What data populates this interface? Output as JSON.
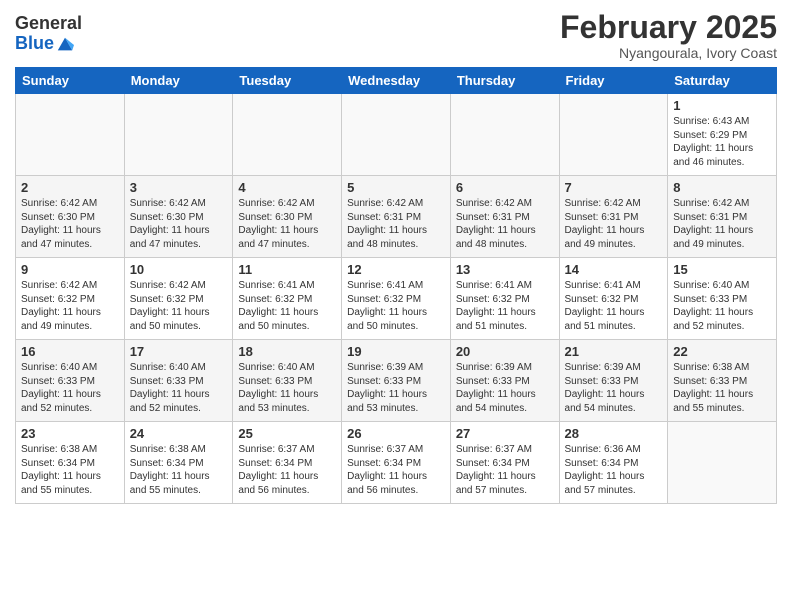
{
  "header": {
    "logo_general": "General",
    "logo_blue": "Blue",
    "month_title": "February 2025",
    "subtitle": "Nyangourala, Ivory Coast"
  },
  "days_of_week": [
    "Sunday",
    "Monday",
    "Tuesday",
    "Wednesday",
    "Thursday",
    "Friday",
    "Saturday"
  ],
  "weeks": [
    [
      {
        "day": "",
        "info": ""
      },
      {
        "day": "",
        "info": ""
      },
      {
        "day": "",
        "info": ""
      },
      {
        "day": "",
        "info": ""
      },
      {
        "day": "",
        "info": ""
      },
      {
        "day": "",
        "info": ""
      },
      {
        "day": "1",
        "info": "Sunrise: 6:43 AM\nSunset: 6:29 PM\nDaylight: 11 hours and 46 minutes."
      }
    ],
    [
      {
        "day": "2",
        "info": "Sunrise: 6:42 AM\nSunset: 6:30 PM\nDaylight: 11 hours and 47 minutes."
      },
      {
        "day": "3",
        "info": "Sunrise: 6:42 AM\nSunset: 6:30 PM\nDaylight: 11 hours and 47 minutes."
      },
      {
        "day": "4",
        "info": "Sunrise: 6:42 AM\nSunset: 6:30 PM\nDaylight: 11 hours and 47 minutes."
      },
      {
        "day": "5",
        "info": "Sunrise: 6:42 AM\nSunset: 6:31 PM\nDaylight: 11 hours and 48 minutes."
      },
      {
        "day": "6",
        "info": "Sunrise: 6:42 AM\nSunset: 6:31 PM\nDaylight: 11 hours and 48 minutes."
      },
      {
        "day": "7",
        "info": "Sunrise: 6:42 AM\nSunset: 6:31 PM\nDaylight: 11 hours and 49 minutes."
      },
      {
        "day": "8",
        "info": "Sunrise: 6:42 AM\nSunset: 6:31 PM\nDaylight: 11 hours and 49 minutes."
      }
    ],
    [
      {
        "day": "9",
        "info": "Sunrise: 6:42 AM\nSunset: 6:32 PM\nDaylight: 11 hours and 49 minutes."
      },
      {
        "day": "10",
        "info": "Sunrise: 6:42 AM\nSunset: 6:32 PM\nDaylight: 11 hours and 50 minutes."
      },
      {
        "day": "11",
        "info": "Sunrise: 6:41 AM\nSunset: 6:32 PM\nDaylight: 11 hours and 50 minutes."
      },
      {
        "day": "12",
        "info": "Sunrise: 6:41 AM\nSunset: 6:32 PM\nDaylight: 11 hours and 50 minutes."
      },
      {
        "day": "13",
        "info": "Sunrise: 6:41 AM\nSunset: 6:32 PM\nDaylight: 11 hours and 51 minutes."
      },
      {
        "day": "14",
        "info": "Sunrise: 6:41 AM\nSunset: 6:32 PM\nDaylight: 11 hours and 51 minutes."
      },
      {
        "day": "15",
        "info": "Sunrise: 6:40 AM\nSunset: 6:33 PM\nDaylight: 11 hours and 52 minutes."
      }
    ],
    [
      {
        "day": "16",
        "info": "Sunrise: 6:40 AM\nSunset: 6:33 PM\nDaylight: 11 hours and 52 minutes."
      },
      {
        "day": "17",
        "info": "Sunrise: 6:40 AM\nSunset: 6:33 PM\nDaylight: 11 hours and 52 minutes."
      },
      {
        "day": "18",
        "info": "Sunrise: 6:40 AM\nSunset: 6:33 PM\nDaylight: 11 hours and 53 minutes."
      },
      {
        "day": "19",
        "info": "Sunrise: 6:39 AM\nSunset: 6:33 PM\nDaylight: 11 hours and 53 minutes."
      },
      {
        "day": "20",
        "info": "Sunrise: 6:39 AM\nSunset: 6:33 PM\nDaylight: 11 hours and 54 minutes."
      },
      {
        "day": "21",
        "info": "Sunrise: 6:39 AM\nSunset: 6:33 PM\nDaylight: 11 hours and 54 minutes."
      },
      {
        "day": "22",
        "info": "Sunrise: 6:38 AM\nSunset: 6:33 PM\nDaylight: 11 hours and 55 minutes."
      }
    ],
    [
      {
        "day": "23",
        "info": "Sunrise: 6:38 AM\nSunset: 6:34 PM\nDaylight: 11 hours and 55 minutes."
      },
      {
        "day": "24",
        "info": "Sunrise: 6:38 AM\nSunset: 6:34 PM\nDaylight: 11 hours and 55 minutes."
      },
      {
        "day": "25",
        "info": "Sunrise: 6:37 AM\nSunset: 6:34 PM\nDaylight: 11 hours and 56 minutes."
      },
      {
        "day": "26",
        "info": "Sunrise: 6:37 AM\nSunset: 6:34 PM\nDaylight: 11 hours and 56 minutes."
      },
      {
        "day": "27",
        "info": "Sunrise: 6:37 AM\nSunset: 6:34 PM\nDaylight: 11 hours and 57 minutes."
      },
      {
        "day": "28",
        "info": "Sunrise: 6:36 AM\nSunset: 6:34 PM\nDaylight: 11 hours and 57 minutes."
      },
      {
        "day": "",
        "info": ""
      }
    ]
  ]
}
